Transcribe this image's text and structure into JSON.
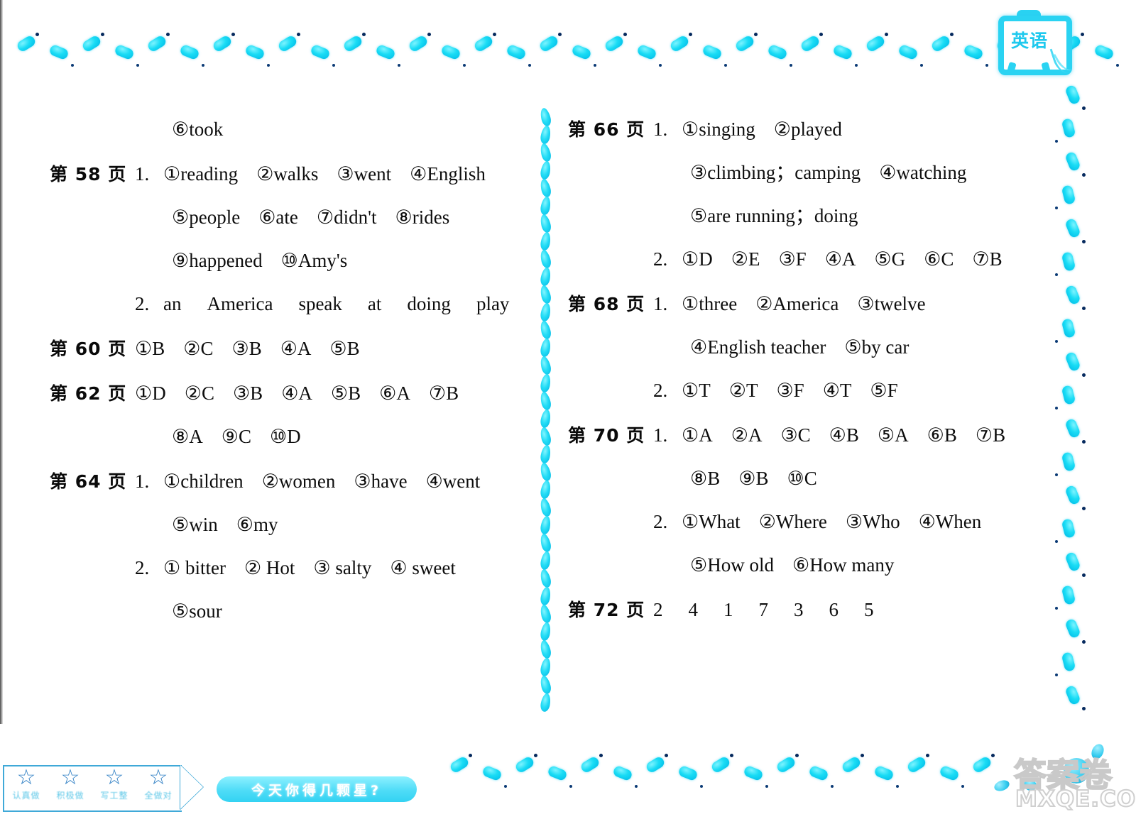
{
  "badge": {
    "label": "英语"
  },
  "left_column": [
    {
      "page_label": "",
      "lines": [
        {
          "indent": 1,
          "items": [
            {
              "num": "⑥",
              "text": "took"
            }
          ]
        }
      ]
    },
    {
      "page_label": "第 58 页",
      "lines": [
        {
          "indent": 0,
          "prefix": "1.",
          "items": [
            {
              "num": "①",
              "text": "reading"
            },
            {
              "num": "②",
              "text": "walks"
            },
            {
              "num": "③",
              "text": "went"
            },
            {
              "num": "④",
              "text": "English"
            }
          ]
        },
        {
          "indent": 1,
          "items": [
            {
              "num": "⑤",
              "text": "people"
            },
            {
              "num": "⑥",
              "text": "ate"
            },
            {
              "num": "⑦",
              "text": "didn't"
            },
            {
              "num": "⑧",
              "text": "rides"
            }
          ]
        },
        {
          "indent": 1,
          "items": [
            {
              "num": "⑨",
              "text": "happened"
            },
            {
              "num": "⑩",
              "text": "Amy's"
            }
          ]
        },
        {
          "indent": 0,
          "prefix": "2.",
          "words": [
            "an",
            "America",
            "speak",
            "at",
            "doing",
            "play"
          ]
        }
      ]
    },
    {
      "page_label": "第 60 页",
      "lines": [
        {
          "indent": 0,
          "items": [
            {
              "num": "①",
              "text": "B"
            },
            {
              "num": "②",
              "text": "C"
            },
            {
              "num": "③",
              "text": "B"
            },
            {
              "num": "④",
              "text": "A"
            },
            {
              "num": "⑤",
              "text": "B"
            }
          ]
        }
      ]
    },
    {
      "page_label": "第 62 页",
      "lines": [
        {
          "indent": 0,
          "items": [
            {
              "num": "①",
              "text": "D"
            },
            {
              "num": "②",
              "text": "C"
            },
            {
              "num": "③",
              "text": "B"
            },
            {
              "num": "④",
              "text": "A"
            },
            {
              "num": "⑤",
              "text": "B"
            },
            {
              "num": "⑥",
              "text": "A"
            },
            {
              "num": "⑦",
              "text": "B"
            }
          ]
        },
        {
          "indent": 1,
          "items": [
            {
              "num": "⑧",
              "text": "A"
            },
            {
              "num": "⑨",
              "text": "C"
            },
            {
              "num": "⑩",
              "text": "D"
            }
          ]
        }
      ]
    },
    {
      "page_label": "第 64 页",
      "lines": [
        {
          "indent": 0,
          "prefix": "1.",
          "items": [
            {
              "num": "①",
              "text": "children"
            },
            {
              "num": "②",
              "text": "women"
            },
            {
              "num": "③",
              "text": "have"
            },
            {
              "num": "④",
              "text": "went"
            }
          ]
        },
        {
          "indent": 1,
          "items": [
            {
              "num": "⑤",
              "text": "win"
            },
            {
              "num": "⑥",
              "text": "my"
            }
          ]
        },
        {
          "indent": 0,
          "prefix": "2.",
          "items": [
            {
              "num": "①",
              "text": " bitter"
            },
            {
              "num": "②",
              "text": " Hot"
            },
            {
              "num": "③",
              "text": " salty"
            },
            {
              "num": "④",
              "text": " sweet"
            }
          ]
        },
        {
          "indent": 1,
          "items": [
            {
              "num": "⑤",
              "text": "sour"
            }
          ]
        }
      ]
    }
  ],
  "right_column": [
    {
      "page_label": "第 66 页",
      "lines": [
        {
          "indent": 0,
          "prefix": "1.",
          "items": [
            {
              "num": "①",
              "text": "singing"
            },
            {
              "num": "②",
              "text": "played"
            }
          ]
        },
        {
          "indent": 1,
          "items": [
            {
              "num": "③",
              "text": "climbing；camping"
            },
            {
              "num": "④",
              "text": "watching"
            }
          ]
        },
        {
          "indent": 1,
          "items": [
            {
              "num": "⑤",
              "text": "are running；doing"
            }
          ]
        },
        {
          "indent": 0,
          "prefix": "2.",
          "items": [
            {
              "num": "①",
              "text": "D"
            },
            {
              "num": "②",
              "text": "E"
            },
            {
              "num": "③",
              "text": "F"
            },
            {
              "num": "④",
              "text": "A"
            },
            {
              "num": "⑤",
              "text": "G"
            },
            {
              "num": "⑥",
              "text": "C"
            },
            {
              "num": "⑦",
              "text": "B"
            }
          ]
        }
      ]
    },
    {
      "page_label": "第 68 页",
      "lines": [
        {
          "indent": 0,
          "prefix": "1.",
          "items": [
            {
              "num": "①",
              "text": "three"
            },
            {
              "num": "②",
              "text": "America"
            },
            {
              "num": "③",
              "text": "twelve"
            }
          ]
        },
        {
          "indent": 1,
          "items": [
            {
              "num": "④",
              "text": "English teacher"
            },
            {
              "num": "⑤",
              "text": "by car"
            }
          ]
        },
        {
          "indent": 0,
          "prefix": "2.",
          "items": [
            {
              "num": "①",
              "text": "T"
            },
            {
              "num": "②",
              "text": "T"
            },
            {
              "num": "③",
              "text": "F"
            },
            {
              "num": "④",
              "text": "T"
            },
            {
              "num": "⑤",
              "text": "F"
            }
          ]
        }
      ]
    },
    {
      "page_label": "第 70 页",
      "lines": [
        {
          "indent": 0,
          "prefix": "1.",
          "items": [
            {
              "num": "①",
              "text": "A"
            },
            {
              "num": "②",
              "text": "A"
            },
            {
              "num": "③",
              "text": "C"
            },
            {
              "num": "④",
              "text": "B"
            },
            {
              "num": "⑤",
              "text": "A"
            },
            {
              "num": "⑥",
              "text": "B"
            },
            {
              "num": "⑦",
              "text": "B"
            }
          ]
        },
        {
          "indent": 1,
          "items": [
            {
              "num": "⑧",
              "text": "B"
            },
            {
              "num": "⑨",
              "text": "B"
            },
            {
              "num": "⑩",
              "text": "C"
            }
          ]
        },
        {
          "indent": 0,
          "prefix": "2.",
          "items": [
            {
              "num": "①",
              "text": "What"
            },
            {
              "num": "②",
              "text": "Where"
            },
            {
              "num": "③",
              "text": "Who"
            },
            {
              "num": "④",
              "text": "When"
            }
          ]
        },
        {
          "indent": 1,
          "items": [
            {
              "num": "⑤",
              "text": "How old"
            },
            {
              "num": "⑥",
              "text": "How many"
            }
          ]
        }
      ]
    },
    {
      "page_label": "第 72 页",
      "lines": [
        {
          "indent": 0,
          "words": [
            "2",
            "4",
            "1",
            "7",
            "3",
            "6",
            "5"
          ]
        }
      ]
    }
  ],
  "footer": {
    "star_glyph": "☆",
    "star_captions": [
      "认真做",
      "积极做",
      "写工整",
      "全做对"
    ],
    "banner_text": "今天你得几颗星?"
  },
  "watermark": {
    "cn": "答案卷",
    "en": "MXQE.COM"
  },
  "colors": {
    "accent_cyan": "#2ad3f2",
    "deep_cyan": "#00b9e6",
    "dot_navy": "#062a5e",
    "text_black": "#0d0d0d",
    "star_blue": "#2f7fc4"
  }
}
